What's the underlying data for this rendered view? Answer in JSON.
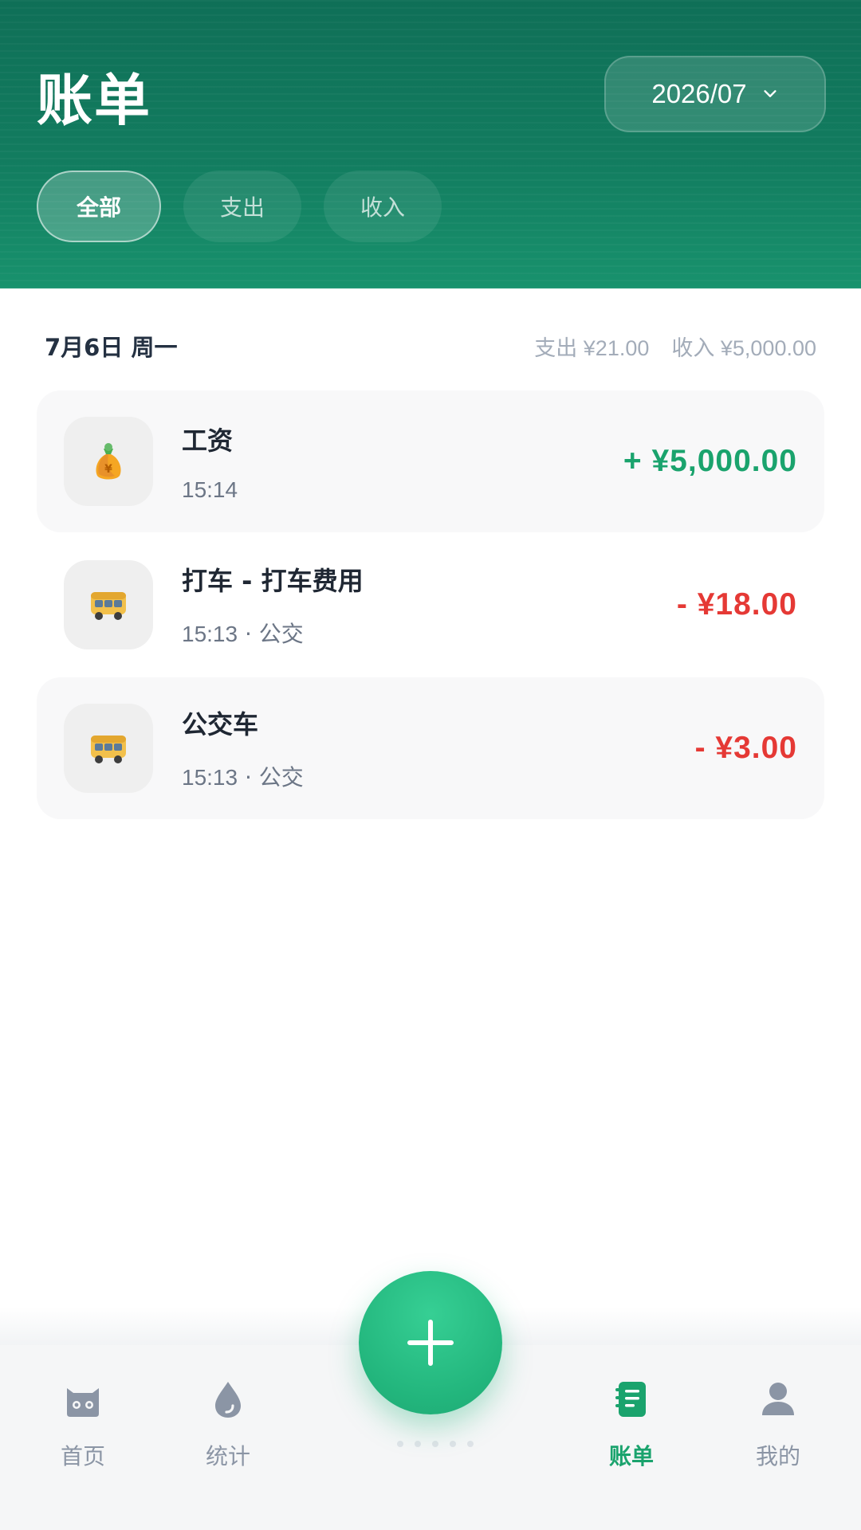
{
  "header": {
    "title": "账单",
    "month": "2026/07",
    "tabs": [
      {
        "label": "全部",
        "active": true
      },
      {
        "label": "支出",
        "active": false
      },
      {
        "label": "收入",
        "active": false
      }
    ]
  },
  "day_group": {
    "date": "7月6日 周一",
    "expense_summary": "支出 ¥21.00",
    "income_summary": "收入 ¥5,000.00"
  },
  "transactions": [
    {
      "title": "工资",
      "time": "15:14",
      "category": "",
      "amount": "+ ¥5,000.00",
      "type": "income",
      "icon": "money-bag-icon"
    },
    {
      "title": "打车 - 打车费用",
      "time": "15:13",
      "category": "公交",
      "amount": "- ¥18.00",
      "type": "expense",
      "icon": "bus-icon"
    },
    {
      "title": "公交车",
      "time": "15:13",
      "category": "公交",
      "amount": "- ¥3.00",
      "type": "expense",
      "icon": "bus-icon"
    }
  ],
  "bottom_nav": [
    {
      "label": "首页",
      "icon": "home-icon",
      "active": false
    },
    {
      "label": "统计",
      "icon": "drop-icon",
      "active": false
    },
    {
      "label": "账单",
      "icon": "bill-icon",
      "active": true
    },
    {
      "label": "我的",
      "icon": "user-icon",
      "active": false
    }
  ],
  "colors": {
    "header_green": "#127c5f",
    "accent_green": "#1aa36d",
    "expense_red": "#e53935",
    "nav_gray": "#8b95a5"
  }
}
